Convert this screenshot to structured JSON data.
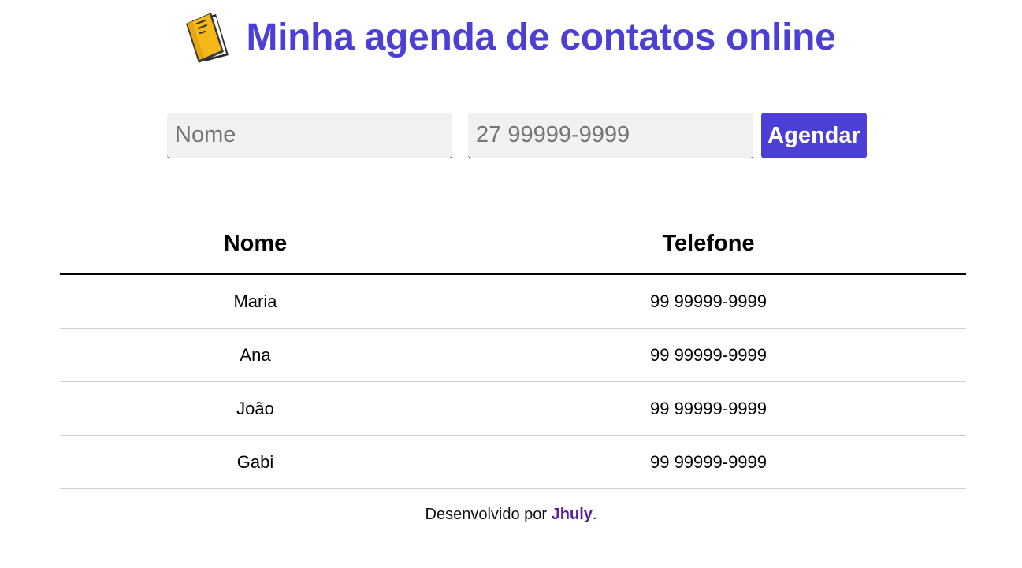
{
  "header": {
    "title": "Minha agenda de contatos online",
    "icon": "book-icon",
    "accent_color": "#4b3fd6"
  },
  "form": {
    "name_placeholder": "Nome",
    "name_value": "",
    "phone_placeholder": "27 99999-9999",
    "phone_value": "",
    "submit_label": "Agendar"
  },
  "table": {
    "headers": [
      "Nome",
      "Telefone"
    ],
    "rows": [
      {
        "name": "Maria",
        "phone": "99 99999-9999"
      },
      {
        "name": "Ana",
        "phone": "99 99999-9999"
      },
      {
        "name": "João",
        "phone": "99 99999-9999"
      },
      {
        "name": "Gabi",
        "phone": "99 99999-9999"
      }
    ]
  },
  "footer": {
    "prefix": "Desenvolvido por ",
    "author": "Jhuly",
    "suffix": "."
  }
}
